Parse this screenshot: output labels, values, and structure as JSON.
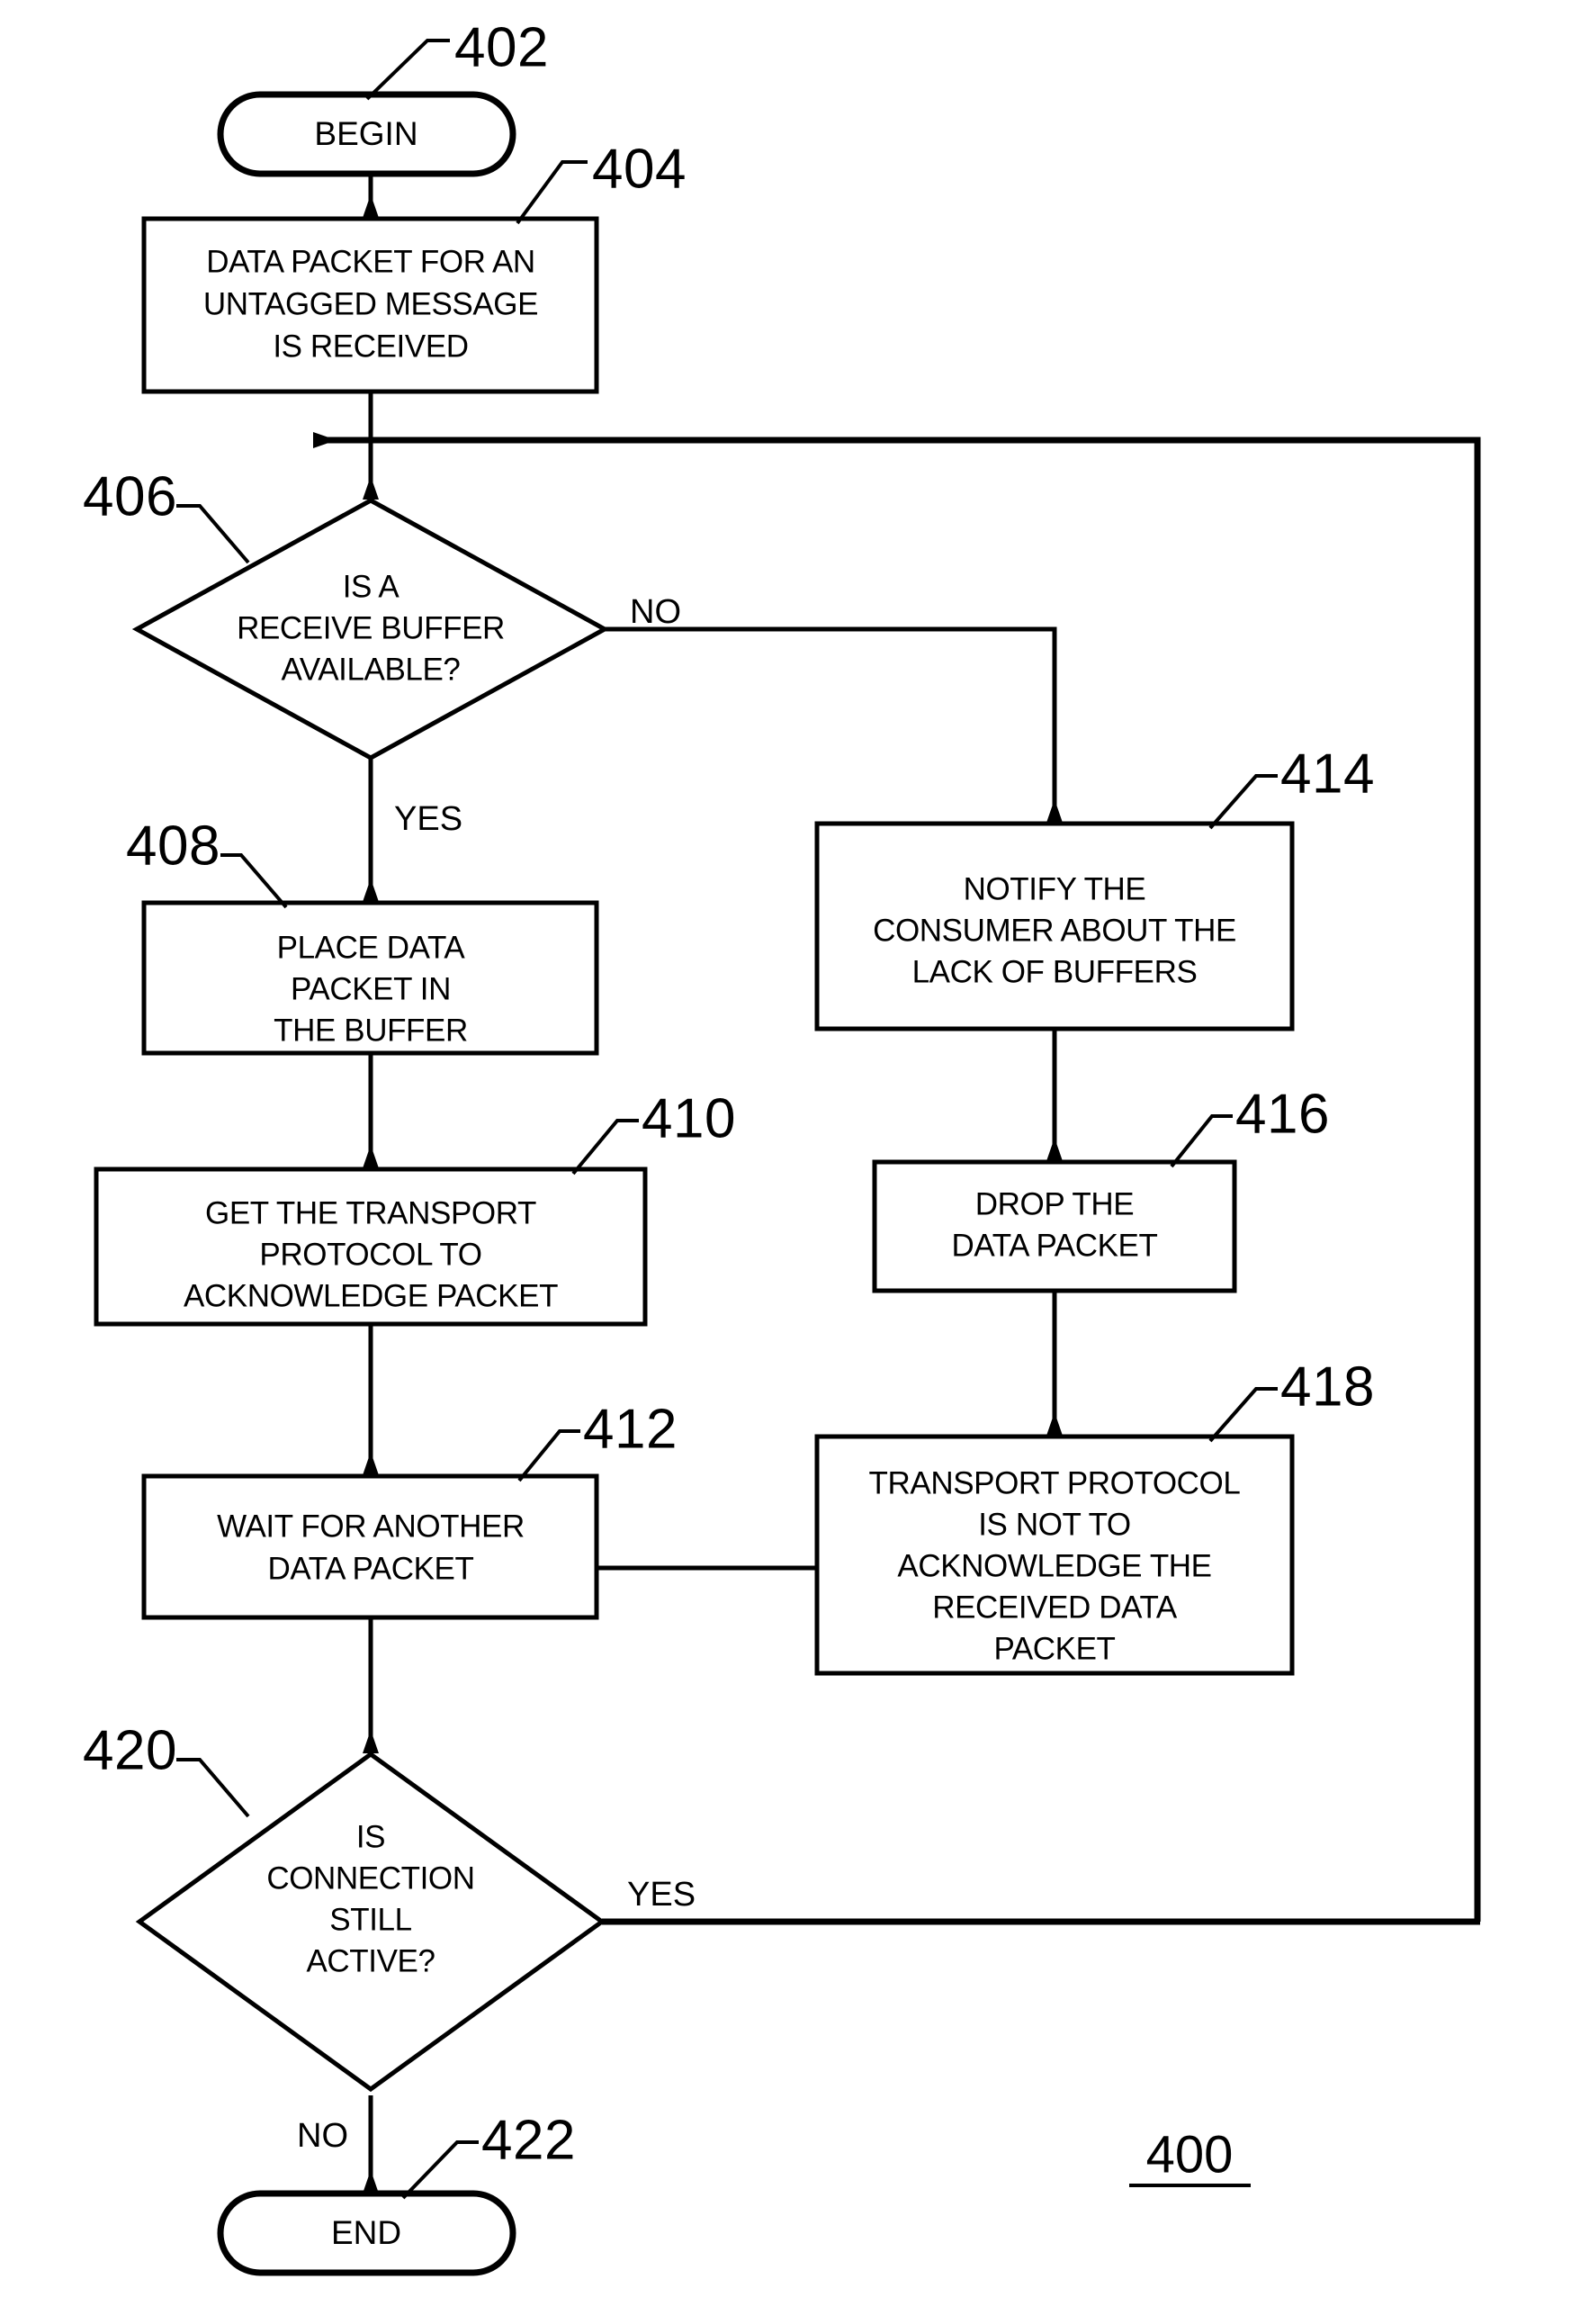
{
  "figure": {
    "label": "400",
    "underlined": true
  },
  "colors": {
    "stroke": "#000000",
    "fill": "#ffffff",
    "background": "#ffffff"
  },
  "nodes": {
    "begin": {
      "ref": "402",
      "type": "terminator",
      "text": "BEGIN"
    },
    "receive": {
      "ref": "404",
      "type": "process",
      "lines": [
        "DATA PACKET FOR AN",
        "UNTAGGED MESSAGE",
        "IS RECEIVED"
      ]
    },
    "buffer_check": {
      "ref": "406",
      "type": "decision",
      "lines": [
        "IS A",
        "RECEIVE BUFFER",
        "AVAILABLE?"
      ],
      "yes_label": "YES",
      "no_label": "NO"
    },
    "place_packet": {
      "ref": "408",
      "type": "process",
      "lines": [
        "PLACE DATA",
        "PACKET IN",
        "THE BUFFER"
      ]
    },
    "get_transport": {
      "ref": "410",
      "type": "process",
      "lines": [
        "GET THE TRANSPORT",
        "PROTOCOL TO",
        "ACKNOWLEDGE PACKET"
      ]
    },
    "wait_packet": {
      "ref": "412",
      "type": "process",
      "lines": [
        "WAIT FOR ANOTHER",
        "DATA PACKET"
      ]
    },
    "notify_consumer": {
      "ref": "414",
      "type": "process",
      "lines": [
        "NOTIFY THE",
        "CONSUMER ABOUT THE",
        "LACK OF BUFFERS"
      ]
    },
    "drop_packet": {
      "ref": "416",
      "type": "process",
      "lines": [
        "DROP THE",
        "DATA PACKET"
      ]
    },
    "no_ack": {
      "ref": "418",
      "type": "process",
      "lines": [
        "TRANSPORT PROTOCOL",
        "IS NOT TO",
        "ACKNOWLEDGE THE",
        "RECEIVED DATA",
        "PACKET"
      ]
    },
    "connection_check": {
      "ref": "420",
      "type": "decision",
      "lines": [
        "IS",
        "CONNECTION",
        "STILL",
        "ACTIVE?"
      ],
      "yes_label": "YES",
      "no_label": "NO"
    },
    "end": {
      "ref": "422",
      "type": "terminator",
      "text": "END"
    }
  }
}
